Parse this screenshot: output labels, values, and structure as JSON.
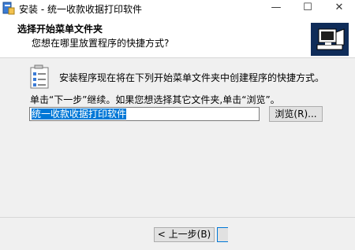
{
  "window": {
    "title": "安装 - 统一收款收据打印软件",
    "minimize_glyph": "—",
    "maximize_glyph": "☐",
    "close_glyph": "✕"
  },
  "header": {
    "title": "选择开始菜单文件夹",
    "subtitle": "您想在哪里放置程序的快捷方式?",
    "image_icon": "wizard-computer-icon"
  },
  "content": {
    "info_icon": "start-menu-folder-icon",
    "info_text": "安装程序现在将在下列开始菜单文件夹中创建程序的快捷方式。",
    "instruction_text": "单击“下一步”继续。如果您想选择其它文件夹,单击“浏览”。",
    "folder_input_value": "统一收款收据打印软件",
    "browse_label": "浏览(R)..."
  },
  "footer": {
    "back_label": "< 上一步(B)"
  },
  "colors": {
    "selection": "#0078d7",
    "header_bg": "#ffffff",
    "body_bg": "#f0f0f0"
  }
}
